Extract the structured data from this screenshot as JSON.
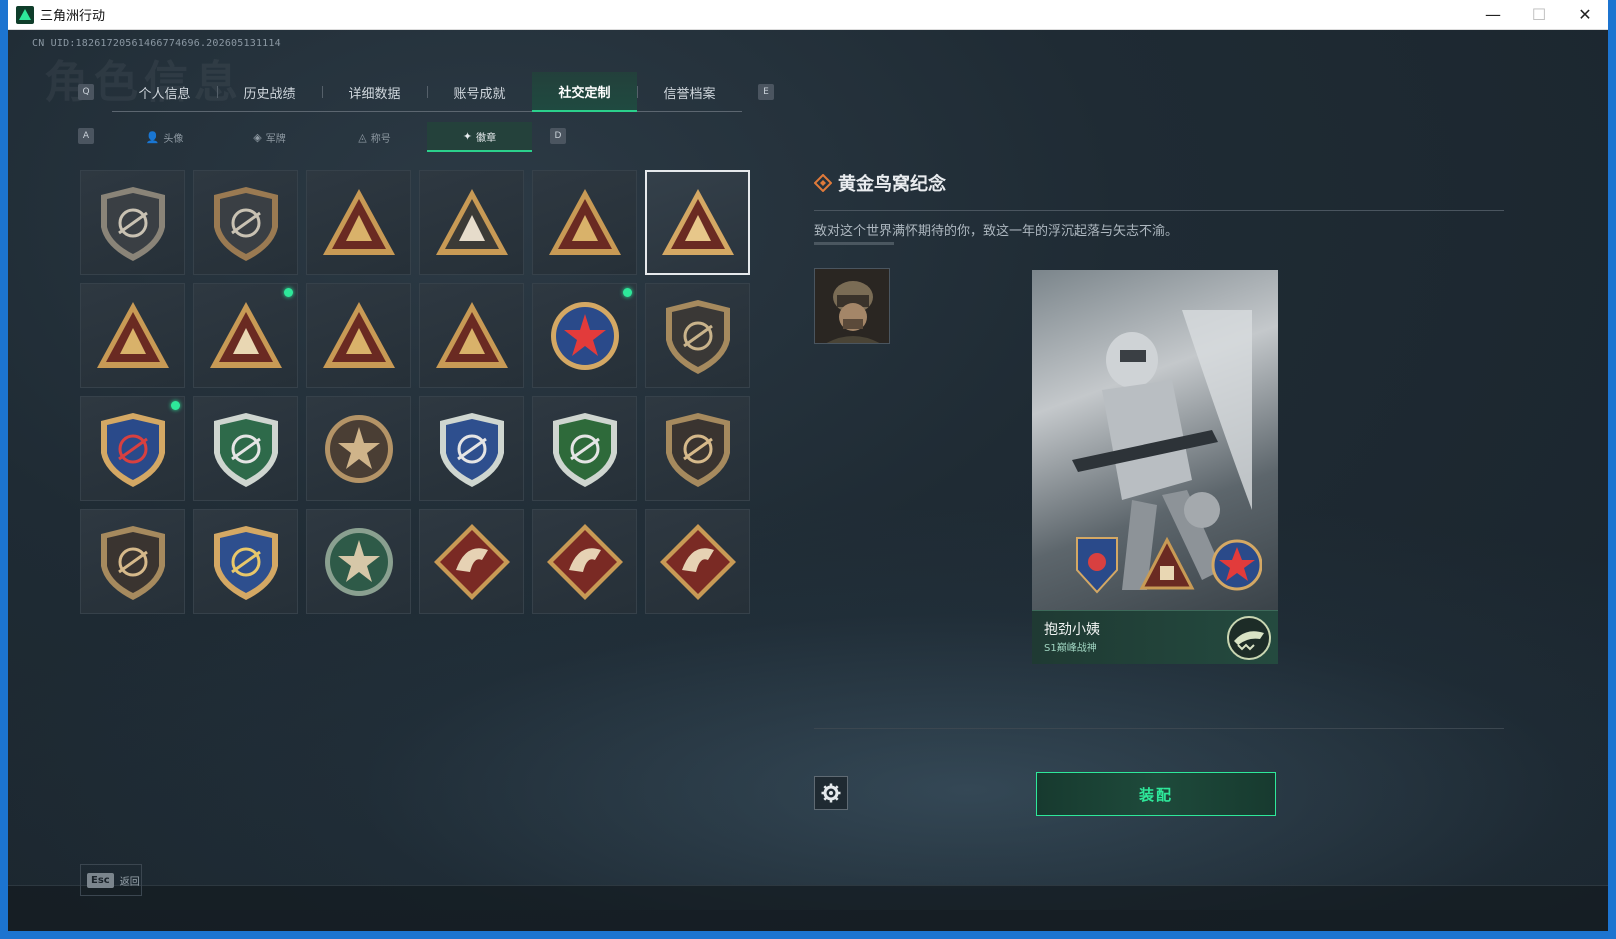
{
  "window": {
    "title": "三角洲行动",
    "minimize": "—",
    "maximize": "☐",
    "close": "✕"
  },
  "uid": "CN UID:18261720561466774696.202605131114",
  "watermark": "角色信息",
  "tabs": {
    "left_key": "Q",
    "right_key": "E",
    "items": [
      {
        "label": "个人信息",
        "active": false
      },
      {
        "label": "历史战绩",
        "active": false
      },
      {
        "label": "详细数据",
        "active": false
      },
      {
        "label": "账号成就",
        "active": false
      },
      {
        "label": "社交定制",
        "active": true
      },
      {
        "label": "信誉档案",
        "active": false
      }
    ]
  },
  "subtabs": {
    "left_key": "A",
    "right_key": "D",
    "items": [
      {
        "label": "头像",
        "icon": "person-icon",
        "active": false
      },
      {
        "label": "军牌",
        "icon": "tag-icon",
        "active": false
      },
      {
        "label": "称号",
        "icon": "title-icon",
        "active": false
      },
      {
        "label": "徽章",
        "icon": "badge-icon",
        "active": true
      }
    ]
  },
  "badges": [
    {
      "shape": "shield",
      "fill": "#3a3f44",
      "accent": "#c9c2b3",
      "border": "#8a8478",
      "selected": false,
      "new": false
    },
    {
      "shape": "shield",
      "fill": "#3a3f44",
      "accent": "#c9c2b3",
      "border": "#9a7a52",
      "selected": false,
      "new": false
    },
    {
      "shape": "triangle",
      "fill": "#6a2a22",
      "accent": "#d9b26a",
      "border": "#c89a55",
      "selected": false,
      "new": false
    },
    {
      "shape": "triangle",
      "fill": "#3b3a36",
      "accent": "#e6dccb",
      "border": "#c89a55",
      "selected": false,
      "new": false
    },
    {
      "shape": "triangle",
      "fill": "#6a2a22",
      "accent": "#d9b26a",
      "border": "#c89a55",
      "selected": false,
      "new": false
    },
    {
      "shape": "triangle",
      "fill": "#6a2a22",
      "accent": "#e7c78a",
      "border": "#d4a864",
      "selected": true,
      "new": false
    },
    {
      "shape": "triangle",
      "fill": "#6a2a22",
      "accent": "#d9b26a",
      "border": "#c89a55",
      "selected": false,
      "new": false
    },
    {
      "shape": "triangle",
      "fill": "#6a2a22",
      "accent": "#e9d7b3",
      "border": "#c89a55",
      "selected": false,
      "new": true
    },
    {
      "shape": "triangle",
      "fill": "#6a2a22",
      "accent": "#d9b26a",
      "border": "#c89a55",
      "selected": false,
      "new": false
    },
    {
      "shape": "triangle",
      "fill": "#6a2a22",
      "accent": "#d9b26a",
      "border": "#c89a55",
      "selected": false,
      "new": false
    },
    {
      "shape": "round",
      "fill": "#2a4a8a",
      "accent": "#e23b3b",
      "border": "#d4a864",
      "selected": false,
      "new": true
    },
    {
      "shape": "shield",
      "fill": "#3a3836",
      "accent": "#c9b38b",
      "border": "#a68a5e",
      "selected": false,
      "new": false
    },
    {
      "shape": "shield",
      "fill": "#2a4a8a",
      "accent": "#d84040",
      "border": "#d4a864",
      "selected": false,
      "new": true
    },
    {
      "shape": "shield",
      "fill": "#2e6a4a",
      "accent": "#e5e5e5",
      "border": "#cfd6d0",
      "selected": false,
      "new": false
    },
    {
      "shape": "round",
      "fill": "#4a3e34",
      "accent": "#cfb48a",
      "border": "#b49467",
      "selected": false,
      "new": false
    },
    {
      "shape": "shield",
      "fill": "#2e4f8e",
      "accent": "#e5e5e5",
      "border": "#cfd6d0",
      "selected": false,
      "new": false
    },
    {
      "shape": "shield",
      "fill": "#2e6a3a",
      "accent": "#e5e5e5",
      "border": "#cfd6d0",
      "selected": false,
      "new": false
    },
    {
      "shape": "shield",
      "fill": "#3a3430",
      "accent": "#d6b98a",
      "border": "#a68a5e",
      "selected": false,
      "new": false
    },
    {
      "shape": "shield",
      "fill": "#3a3430",
      "accent": "#d6b98a",
      "border": "#a68a5e",
      "selected": false,
      "new": false
    },
    {
      "shape": "shield",
      "fill": "#2e4f8e",
      "accent": "#e8c76a",
      "border": "#d4a864",
      "selected": false,
      "new": false
    },
    {
      "shape": "round",
      "fill": "#2e5a48",
      "accent": "#d6c7a8",
      "border": "#8aa090",
      "selected": false,
      "new": false
    },
    {
      "shape": "diamond",
      "fill": "#7a2a24",
      "accent": "#e6d2b4",
      "border": "#c89a55",
      "selected": false,
      "new": false
    },
    {
      "shape": "diamond",
      "fill": "#7a2a24",
      "accent": "#e6d2b4",
      "border": "#c89a55",
      "selected": false,
      "new": false
    },
    {
      "shape": "diamond",
      "fill": "#7a2a24",
      "accent": "#e6d2b4",
      "border": "#c89a55",
      "selected": false,
      "new": false
    }
  ],
  "detail": {
    "title": "黄金鸟窝纪念",
    "description": "致对这个世界满怀期待的你，致这一年的浮沉起落与矢志不渝。"
  },
  "card": {
    "player_name": "抱劲小姨",
    "player_rank": "S1巅峰战神"
  },
  "actions": {
    "equip_label": "装配",
    "settings_icon": "gear-icon"
  },
  "footer": {
    "esc_key": "Esc",
    "esc_label": "返回"
  },
  "colors": {
    "accent": "#2ee89a",
    "new_dot": "#2ee89a"
  }
}
